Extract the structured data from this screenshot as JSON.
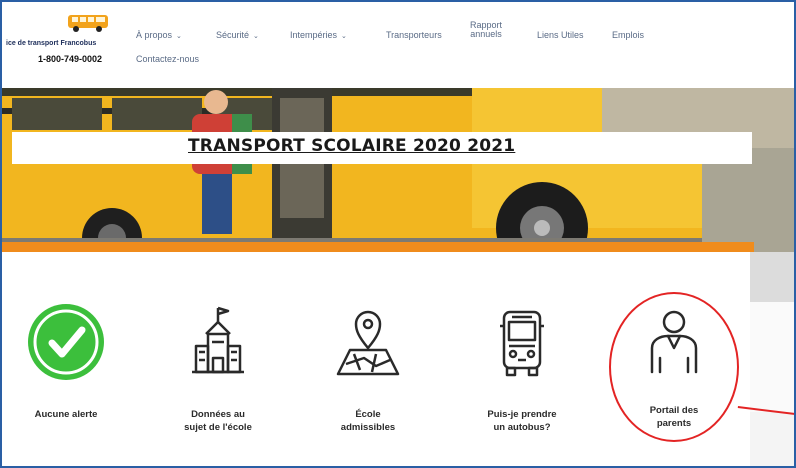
{
  "brand": {
    "name": "ice de transport Francobus",
    "phone": "1-800-749-0002",
    "bus_color": "#f2a31c"
  },
  "nav": {
    "items": [
      {
        "label": "À propos",
        "dropdown": true
      },
      {
        "label": "Sécurité",
        "dropdown": true
      },
      {
        "label": "Intempéries",
        "dropdown": true
      },
      {
        "label": "Transporteurs",
        "dropdown": false
      },
      {
        "label_line1": "Rapport",
        "label_line2": "annuels",
        "dropdown": false
      },
      {
        "label": "Liens Utiles",
        "dropdown": false
      },
      {
        "label": "Emplois",
        "dropdown": false
      },
      {
        "label": "Contactez-nous",
        "dropdown": false
      }
    ],
    "chevron": "⌄"
  },
  "hero": {
    "title": "TRANSPORT SCOLAIRE 2020 2021",
    "accent_color": "#f08c1c"
  },
  "cards": [
    {
      "icon": "check-circle-icon",
      "line1": "Aucune alerte",
      "line2": "",
      "color": "#3cbf3c"
    },
    {
      "icon": "school-icon",
      "line1": "Données au",
      "line2": "sujet de l'école"
    },
    {
      "icon": "map-pin-icon",
      "line1": "École",
      "line2": "admissibles"
    },
    {
      "icon": "bus-icon",
      "line1": "Puis-je prendre",
      "line2": "un autobus?"
    },
    {
      "icon": "parent-icon",
      "line1": "Portail des",
      "line2": "parents"
    }
  ],
  "annotation": {
    "highlight_color": "#e32424",
    "target": "Portail des parents"
  }
}
